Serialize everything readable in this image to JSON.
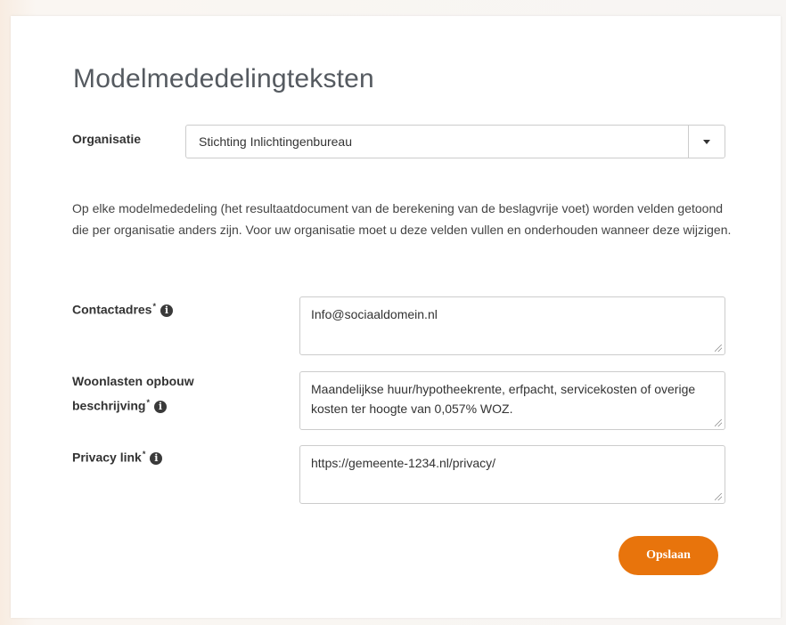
{
  "page": {
    "title": "Modelmededelingteksten",
    "description": "Op elke modelmededeling (het resultaatdocument van de berekening van de beslagvrije voet) worden velden getoond die per organisatie anders zijn. Voor uw organisatie moet u deze velden vullen en onderhouden wanneer deze wijzigen."
  },
  "organisation": {
    "label": "Organisatie",
    "selected": "Stichting Inlichtingenbureau"
  },
  "fields": {
    "contact": {
      "label": "Contactadres",
      "required_mark": "*",
      "value": "Info@sociaaldomein.nl",
      "icon": "info-icon"
    },
    "housing": {
      "label_line1": "Woonlasten opbouw",
      "label_line2": "beschrijving",
      "required_mark": "*",
      "value": "Maandelijkse huur/hypotheekrente, erfpacht, servicekosten of overige kosten ter hoogte van 0,057% WOZ.",
      "icon": "info-icon"
    },
    "privacy": {
      "label": "Privacy link",
      "required_mark": "*",
      "value": "https://gemeente-1234.nl/privacy/",
      "icon": "info-icon"
    }
  },
  "actions": {
    "save_label": "Opslaan"
  },
  "colors": {
    "accent": "#e8740c",
    "title": "#555a60"
  }
}
